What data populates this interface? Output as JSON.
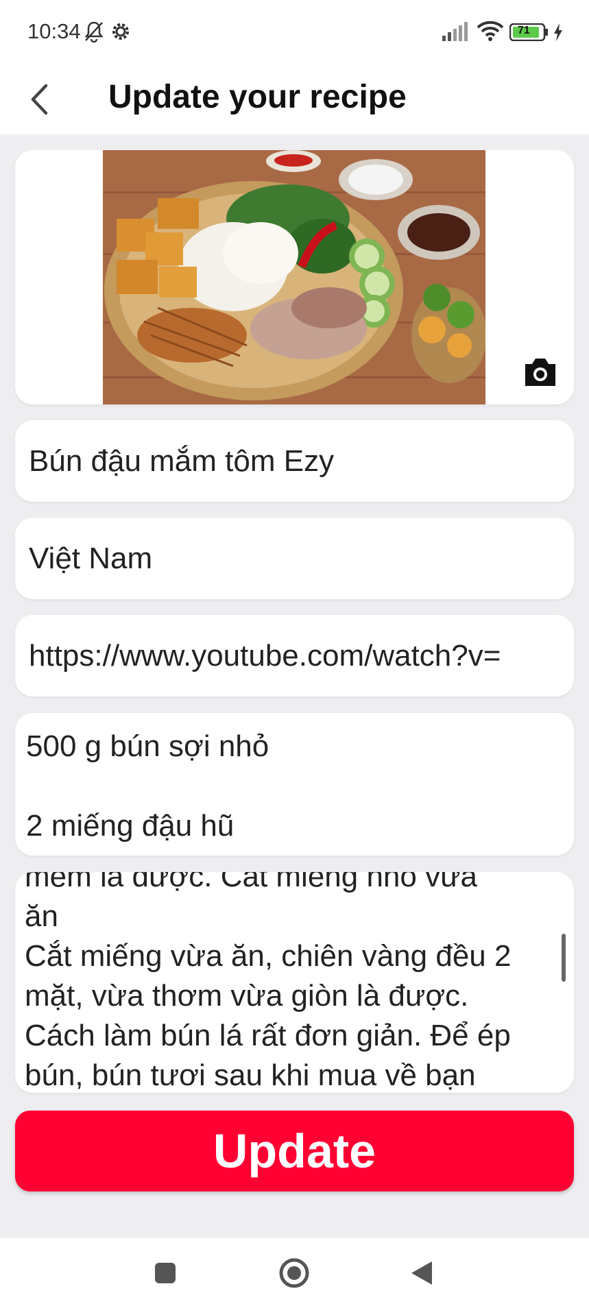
{
  "status_bar": {
    "time": "10:34",
    "battery": "71",
    "icons": [
      "bell-off-icon",
      "gear-icon",
      "signal-icon",
      "wifi-icon",
      "battery-icon",
      "charging-icon"
    ]
  },
  "header": {
    "title": "Update your recipe",
    "back_icon": "chevron-left-icon"
  },
  "image_card": {
    "camera_icon": "camera-icon"
  },
  "form": {
    "name": "Bún đậu mắm tôm Ezy",
    "country": "Việt Nam",
    "video_url": "https://www.youtube.com/watch?v=",
    "ingredients": [
      "500 g bún sợi nhỏ",
      "2 miếng đậu hũ"
    ],
    "instructions": [
      "mềm là được. Cắt miếng nhỏ vừa",
      "ăn",
      "Cắt miếng vừa ăn, chiên vàng đều 2",
      "mặt, vừa thơm vừa giòn là được.",
      "Cách làm bún lá rất đơn giản. Để ép",
      "bún, bún tươi sau khi mua về bạn"
    ]
  },
  "update_button": {
    "label": "Update"
  },
  "colors": {
    "accent": "#ff0033",
    "background": "#eeeef1",
    "card": "#ffffff"
  },
  "nav_bar": {
    "icons": [
      "square-icon",
      "home-circle-icon",
      "back-triangle-icon"
    ]
  }
}
